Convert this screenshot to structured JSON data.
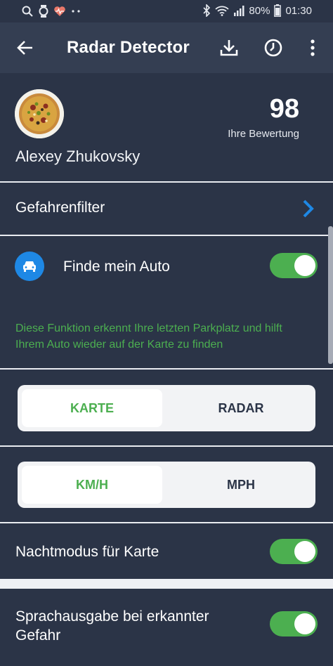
{
  "status_bar": {
    "battery": "80%",
    "time": "01:30",
    "icons": [
      "search-icon",
      "watch-icon",
      "heart-icon",
      "dots-icon",
      "bluetooth-icon",
      "wifi-icon",
      "signal-icon",
      "battery-icon"
    ]
  },
  "app_bar": {
    "title": "Radar Detector",
    "icons": [
      "back-arrow-icon",
      "download-icon",
      "clock-icon",
      "more-vert-icon"
    ]
  },
  "profile": {
    "name": "Alexey Zhukovsky",
    "score": "98",
    "score_label": "Ihre Bewertung"
  },
  "hazard_filter": {
    "label": "Gefahrenfilter"
  },
  "find_car": {
    "label": "Finde mein Auto",
    "enabled": true,
    "description": "Diese Funktion erkennt Ihre letzten Parkplatz und hilft Ihrem Auto wieder auf der Karte zu finden"
  },
  "view_toggle": {
    "options": [
      "KARTE",
      "RADAR"
    ],
    "selected": "KARTE"
  },
  "unit_toggle": {
    "options": [
      "KM/H",
      "MPH"
    ],
    "selected": "KM/H"
  },
  "night_mode": {
    "label": "Nachtmodus für Karte",
    "enabled": true
  },
  "voice_alert": {
    "label": "Sprachausgabe bei erkannter Gefahr",
    "enabled": true
  },
  "colors": {
    "background": "#2b3447",
    "app_bar": "#343e52",
    "accent_green": "#4caf50",
    "accent_blue": "#1e88e5"
  }
}
